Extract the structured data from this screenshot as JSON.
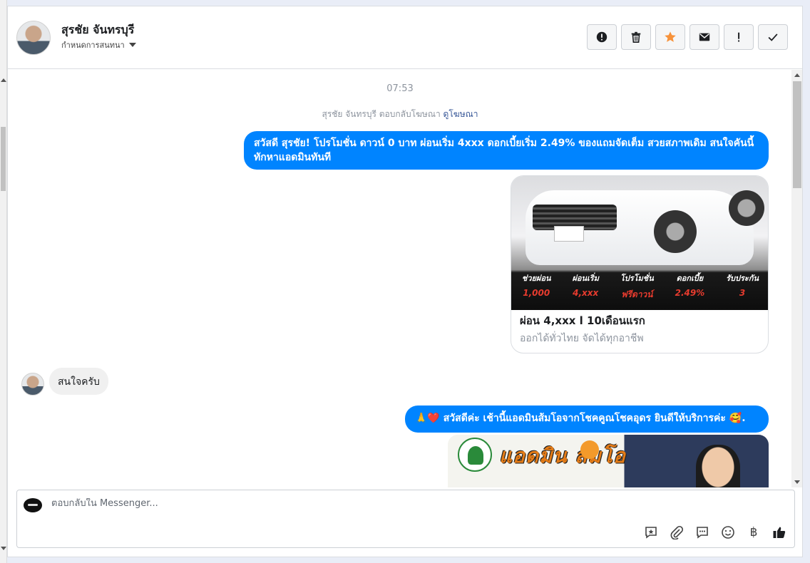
{
  "header": {
    "contact_name": "สุรชัย จันทรบุรี",
    "assign_label": "กำหนดการสนทนา",
    "actions": [
      {
        "name": "report-button",
        "icon": "alert-circle-icon"
      },
      {
        "name": "delete-button",
        "icon": "trash-icon"
      },
      {
        "name": "star-button",
        "icon": "star-icon"
      },
      {
        "name": "mark-unread-button",
        "icon": "envelope-icon"
      },
      {
        "name": "important-button",
        "icon": "exclamation-icon"
      },
      {
        "name": "done-button",
        "icon": "checkmark-icon"
      }
    ],
    "star_color": "#f7923a"
  },
  "conversation": {
    "timestamp": "07:53",
    "reply_note_prefix": "สุรชัย จันทรบุรี ตอบกลับโฆษณา",
    "reply_note_link": "ดูโฆษณา",
    "msg_out_1": "สวัสดี สุรชัย! โปรโมชั่น ดาวน์ 0 บาท ผ่อนเริ่ม 4xxx ดอกเบี้ยเริ่ม 2.49% ของแถมจัดเต็ม สวยสภาพเดิม สนใจคันนี้ทักหาแอดมินทันที",
    "ad_card": {
      "title": "ผ่อน 4,xxx l 10เดือนแรก",
      "subtitle": "ออกได้ทั่วไทย จัดได้ทุกอาชีพ",
      "promo": [
        {
          "label": "ช่วยผ่อน",
          "value": "1,000"
        },
        {
          "label": "ผ่อนเริ่ม",
          "value": "4,xxx"
        },
        {
          "label": "โปรโมชั่น",
          "value": "ฟรีดาวน์"
        },
        {
          "label": "ดอกเบี้ย",
          "value": "2.49%"
        },
        {
          "label": "รับประกัน",
          "value": "3"
        }
      ]
    },
    "msg_in_1": "สนใจครับ",
    "msg_out_2": "🙏❤️ สวัสดีค่ะ เช้านี้แอดมินส้มโอจากโชคคูณโชคอุดร ยินดีให้บริการค่ะ 🥰.",
    "banner_text": "แอดมิน  ส้มโอ",
    "accent_color": "#0084ff"
  },
  "composer": {
    "placeholder": "ตอบกลับใน Messenger...",
    "tools": [
      "saved-reply-icon",
      "attachment-icon",
      "message-icon",
      "emoji-icon",
      "baht-icon",
      "like-icon"
    ],
    "baht_symbol": "฿"
  }
}
